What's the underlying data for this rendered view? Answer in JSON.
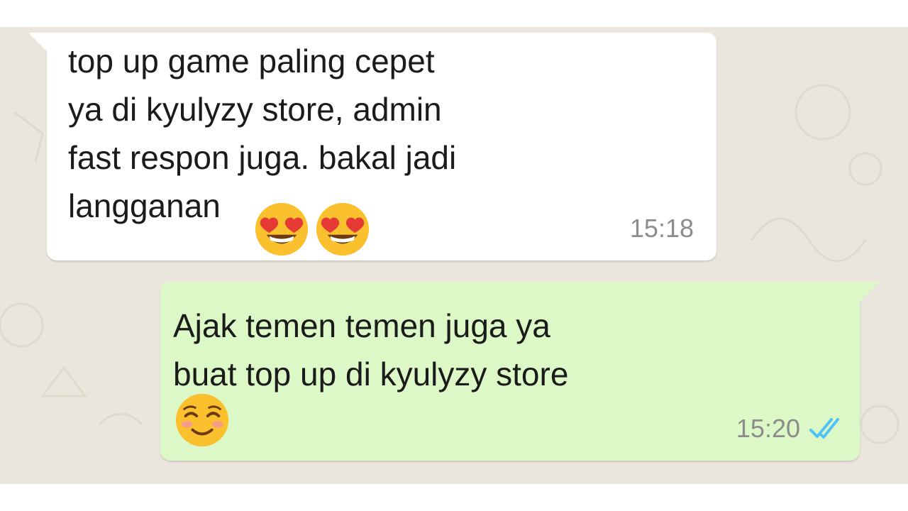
{
  "messages": [
    {
      "direction": "incoming",
      "text": "top up game paling cepet\nya di kyulyzy store, admin\nfast respon juga. bakal jadi\nlangganan",
      "emojis": [
        "smiling-face-with-heart-eyes",
        "smiling-face-with-heart-eyes"
      ],
      "time": "15:18"
    },
    {
      "direction": "outgoing",
      "text": "Ajak temen temen juga ya\nbuat top up di kyulyzy store",
      "emojis": [
        "smiling-face"
      ],
      "time": "15:20",
      "status": "read"
    }
  ],
  "colors": {
    "wallpaper": "#ebe6dd",
    "incoming_bubble": "#ffffff",
    "outgoing_bubble": "#dcf8c6",
    "timestamp": "#8c8c8c",
    "read_ticks": "#4fc3f7",
    "emoji_face": "#fbc02d",
    "emoji_heart": "#e53935"
  }
}
